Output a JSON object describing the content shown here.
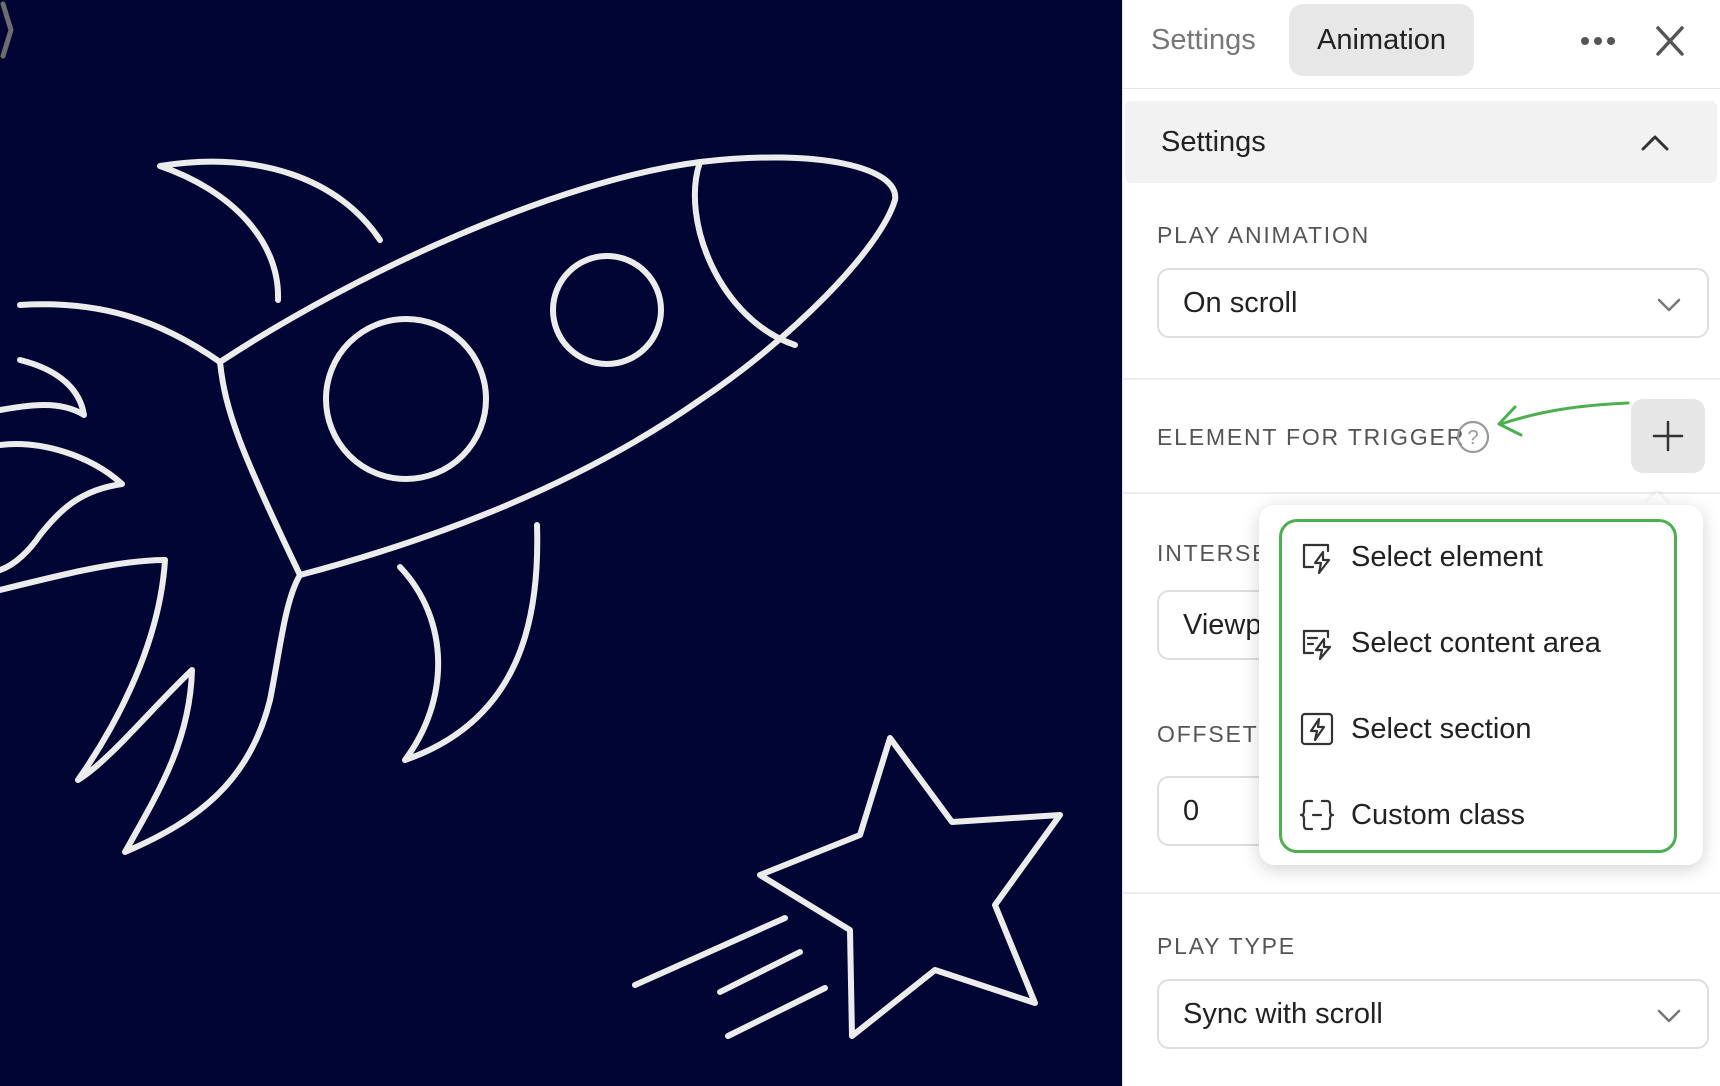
{
  "panel": {
    "tabs": [
      {
        "label": "Settings",
        "active": false
      },
      {
        "label": "Animation",
        "active": true
      }
    ],
    "more_icon": "more-horizontal-icon",
    "close_icon": "close-icon",
    "section": {
      "title": "Settings",
      "icon": "chevron-up-icon"
    },
    "play_animation": {
      "label": "PLAY ANIMATION",
      "value": "On scroll"
    },
    "element_for_trigger": {
      "label": "ELEMENT FOR TRIGGER",
      "help_icon": "question-circle-icon",
      "add_icon": "plus-icon"
    },
    "intersection": {
      "label": "INTERSE",
      "value": "Viewp"
    },
    "offset": {
      "label": "OFFSET I",
      "value": "0"
    },
    "play_type": {
      "label": "PLAY TYPE",
      "value": "Sync with scroll"
    }
  },
  "dropdown": {
    "items": [
      {
        "label": "Select element",
        "icon": "select-element-icon"
      },
      {
        "label": "Select content area",
        "icon": "select-content-area-icon"
      },
      {
        "label": "Select section",
        "icon": "select-section-icon"
      },
      {
        "label": "Custom class",
        "icon": "custom-class-icon"
      }
    ]
  },
  "colors": {
    "canvas_bg": "#000533",
    "accent_green": "#4caf50",
    "active_tab_bg": "#e7e7e7"
  }
}
